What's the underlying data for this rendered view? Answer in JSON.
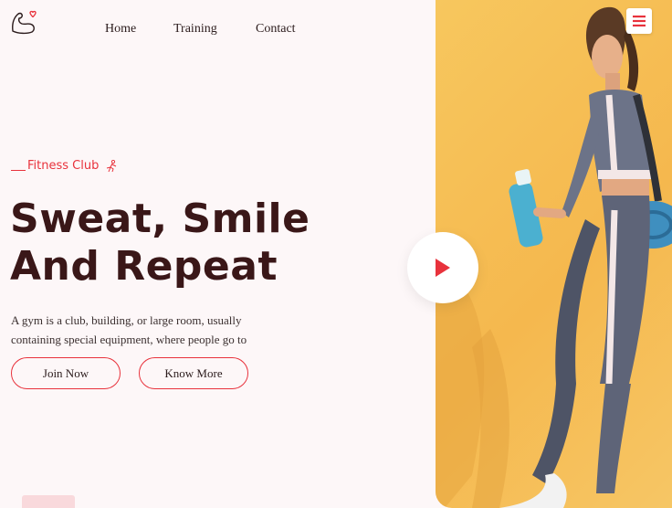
{
  "brand": {
    "logo_icon": "flexed-arm-heart-icon"
  },
  "nav": {
    "items": [
      "Home",
      "Training",
      "Contact"
    ]
  },
  "header": {
    "menu_icon": "hamburger-menu-icon"
  },
  "hero": {
    "eyebrow": "Fitness Club",
    "eyebrow_icon": "running-person-icon",
    "title_line1": "Sweat, Smile",
    "title_line2": "And Repeat",
    "description": "A gym is a club, building, or large room, usually containing special equipment, where people go to",
    "buttons": {
      "join": "Join Now",
      "know_more": "Know More"
    },
    "play_icon": "play-icon"
  },
  "colors": {
    "accent": "#e8323c",
    "heading": "#3a1718",
    "background": "#fdf7f8",
    "image_bg": "#f6c25a"
  }
}
